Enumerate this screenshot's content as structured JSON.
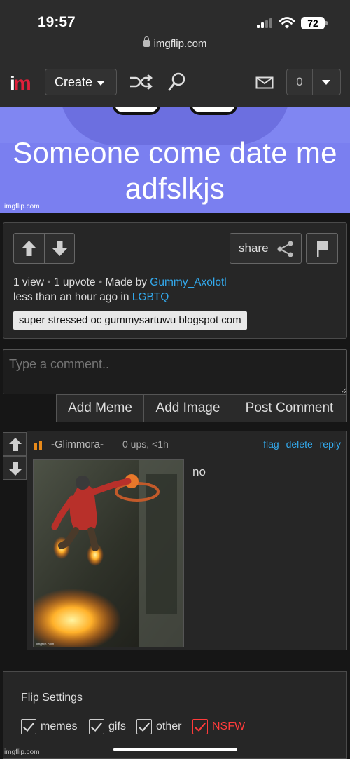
{
  "status_bar": {
    "time": "19:57",
    "battery": "72",
    "url": "imgflip.com"
  },
  "nav": {
    "logo_i": "i",
    "logo_m": "m",
    "create_label": "Create",
    "notification_count": "0"
  },
  "meme": {
    "caption": "Someone come date me adfslkjs",
    "watermark": "imgflip.com"
  },
  "post": {
    "views": "1 view",
    "upvotes": "1 upvote",
    "made_by_prefix": "Made by",
    "author": "Gummy_Axolotl",
    "time_prefix": "less than an hour ago in",
    "stream": "LGBTQ",
    "share_label": "share",
    "tag": "super stressed oc gummysartuwu blogspot com"
  },
  "comment_form": {
    "placeholder": "Type a comment..",
    "add_meme": "Add Meme",
    "add_image": "Add Image",
    "post_comment": "Post Comment"
  },
  "comment": {
    "username": "-Glimmora-",
    "meta": "0 ups, <1h",
    "flag": "flag",
    "delete": "delete",
    "reply": "reply",
    "text": "no",
    "image_watermark": "imgflip.com"
  },
  "flip_settings": {
    "title": "Flip Settings",
    "options": [
      "memes",
      "gifs",
      "other",
      "NSFW"
    ]
  },
  "footer_watermark": "imgflip.com",
  "colors": {
    "accent_link": "#33aaee",
    "nsfw": "#ff3b3b",
    "meme_bg": "#7a7ff0"
  }
}
